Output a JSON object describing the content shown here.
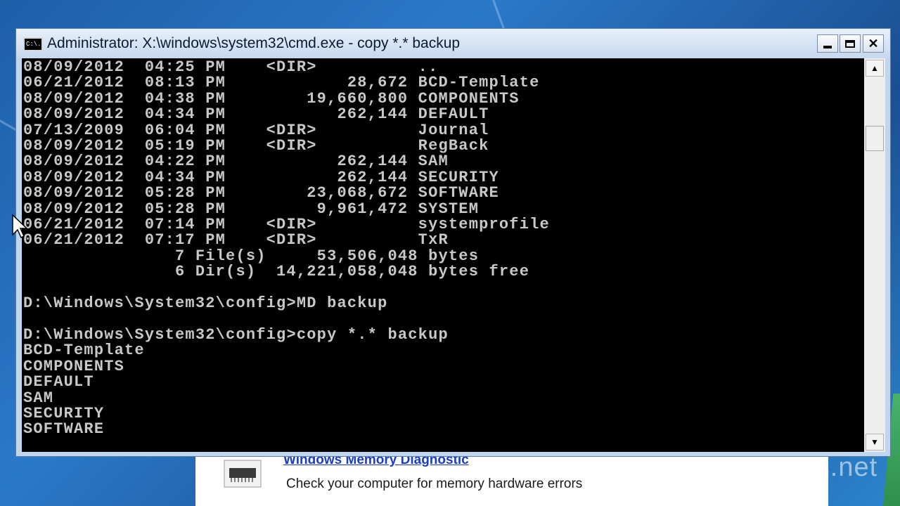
{
  "window": {
    "title": "Administrator: X:\\windows\\system32\\cmd.exe - copy  *.* backup",
    "icon_text": "C:\\."
  },
  "console": {
    "lines": [
      "08/09/2012  04:25 PM    <DIR>          ..",
      "06/21/2012  08:13 PM            28,672 BCD-Template",
      "08/09/2012  04:38 PM        19,660,800 COMPONENTS",
      "08/09/2012  04:34 PM           262,144 DEFAULT",
      "07/13/2009  06:04 PM    <DIR>          Journal",
      "08/09/2012  05:19 PM    <DIR>          RegBack",
      "08/09/2012  04:22 PM           262,144 SAM",
      "08/09/2012  04:34 PM           262,144 SECURITY",
      "08/09/2012  05:28 PM        23,068,672 SOFTWARE",
      "08/09/2012  05:28 PM         9,961,472 SYSTEM",
      "06/21/2012  07:14 PM    <DIR>          systemprofile",
      "06/21/2012  07:17 PM    <DIR>          TxR",
      "               7 File(s)     53,506,048 bytes",
      "               6 Dir(s)  14,221,058,048 bytes free",
      "",
      "D:\\Windows\\System32\\config>MD backup",
      "",
      "D:\\Windows\\System32\\config>copy *.* backup",
      "BCD-Template",
      "COMPONENTS",
      "DEFAULT",
      "SAM",
      "SECURITY",
      "SOFTWARE"
    ]
  },
  "background_window": {
    "link_text": "Windows Memory Diagnostic",
    "description": "Check your computer for memory hardware errors"
  },
  "watermark": "AvoidErrors.net",
  "icons": {
    "app": "cmd-icon",
    "minimize": "minimize-icon",
    "maximize": "maximize-icon",
    "close": "close-icon",
    "scroll_up": "scroll-up-icon",
    "scroll_down": "scroll-down-icon",
    "memory_chip": "memory-chip-icon",
    "cursor": "mouse-pointer-icon"
  },
  "colors": {
    "console_bg": "#000000",
    "console_text": "#c8c8c8",
    "link": "#1a3fc0"
  }
}
